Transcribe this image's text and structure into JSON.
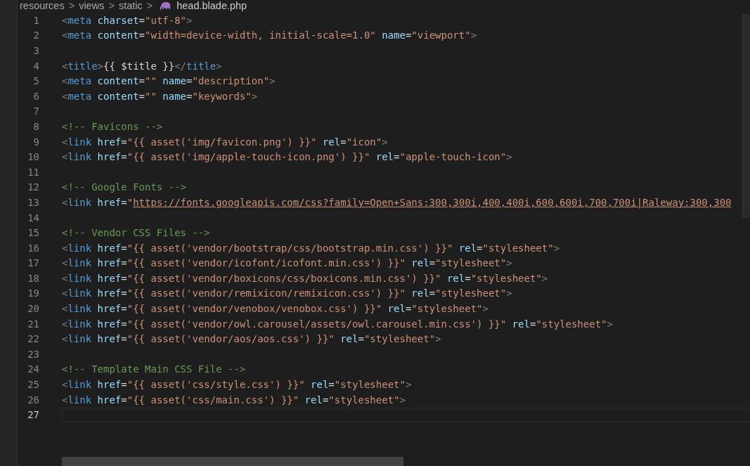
{
  "breadcrumb": {
    "parts": [
      "resources",
      "views",
      "static"
    ],
    "separator": ">",
    "file": "head.blade.php"
  },
  "lines": [
    {
      "number": "1",
      "current": false,
      "segments": [
        {
          "kind": "punct",
          "text": "<"
        },
        {
          "kind": "tag",
          "text": "meta"
        },
        {
          "kind": "attr",
          "text": " charset"
        },
        {
          "kind": "text",
          "text": "="
        },
        {
          "kind": "string",
          "text": "\"utf-8\""
        },
        {
          "kind": "punct",
          "text": ">"
        }
      ]
    },
    {
      "number": "2",
      "current": false,
      "segments": [
        {
          "kind": "punct",
          "text": "<"
        },
        {
          "kind": "tag",
          "text": "meta"
        },
        {
          "kind": "attr",
          "text": " content"
        },
        {
          "kind": "text",
          "text": "="
        },
        {
          "kind": "string",
          "text": "\"width=device-width, initial-scale=1.0\""
        },
        {
          "kind": "attr",
          "text": " name"
        },
        {
          "kind": "text",
          "text": "="
        },
        {
          "kind": "string",
          "text": "\"viewport\""
        },
        {
          "kind": "punct",
          "text": ">"
        }
      ]
    },
    {
      "number": "3",
      "current": false
    },
    {
      "number": "4",
      "current": false,
      "segments": [
        {
          "kind": "punct",
          "text": "<"
        },
        {
          "kind": "tag",
          "text": "title"
        },
        {
          "kind": "punct",
          "text": ">"
        },
        {
          "kind": "text",
          "text": "{{ $title }}"
        },
        {
          "kind": "punct",
          "text": "</"
        },
        {
          "kind": "tag",
          "text": "title"
        },
        {
          "kind": "punct",
          "text": ">"
        }
      ]
    },
    {
      "number": "5",
      "current": false,
      "segments": [
        {
          "kind": "punct",
          "text": "<"
        },
        {
          "kind": "tag",
          "text": "meta"
        },
        {
          "kind": "attr",
          "text": " content"
        },
        {
          "kind": "text",
          "text": "="
        },
        {
          "kind": "string",
          "text": "\"\""
        },
        {
          "kind": "attr",
          "text": " name"
        },
        {
          "kind": "text",
          "text": "="
        },
        {
          "kind": "string",
          "text": "\"description\""
        },
        {
          "kind": "punct",
          "text": ">"
        }
      ]
    },
    {
      "number": "6",
      "current": false,
      "segments": [
        {
          "kind": "punct",
          "text": "<"
        },
        {
          "kind": "tag",
          "text": "meta"
        },
        {
          "kind": "attr",
          "text": " content"
        },
        {
          "kind": "text",
          "text": "="
        },
        {
          "kind": "string",
          "text": "\"\""
        },
        {
          "kind": "attr",
          "text": " name"
        },
        {
          "kind": "text",
          "text": "="
        },
        {
          "kind": "string",
          "text": "\"keywords\""
        },
        {
          "kind": "punct",
          "text": ">"
        }
      ]
    },
    {
      "number": "7",
      "current": false
    },
    {
      "number": "8",
      "current": false,
      "segments": [
        {
          "kind": "comment",
          "text": "<!-- Favicons -->"
        }
      ]
    },
    {
      "number": "9",
      "current": false,
      "segments": [
        {
          "kind": "punct",
          "text": "<"
        },
        {
          "kind": "tag",
          "text": "link"
        },
        {
          "kind": "attr",
          "text": " href"
        },
        {
          "kind": "text",
          "text": "="
        },
        {
          "kind": "string",
          "text": "\"{{ asset('img/favicon.png') }}\""
        },
        {
          "kind": "attr",
          "text": " rel"
        },
        {
          "kind": "text",
          "text": "="
        },
        {
          "kind": "string",
          "text": "\"icon\""
        },
        {
          "kind": "punct",
          "text": ">"
        }
      ]
    },
    {
      "number": "10",
      "current": false,
      "segments": [
        {
          "kind": "punct",
          "text": "<"
        },
        {
          "kind": "tag",
          "text": "link"
        },
        {
          "kind": "attr",
          "text": " href"
        },
        {
          "kind": "text",
          "text": "="
        },
        {
          "kind": "string",
          "text": "\"{{ asset('img/apple-touch-icon.png') }}\""
        },
        {
          "kind": "attr",
          "text": " rel"
        },
        {
          "kind": "text",
          "text": "="
        },
        {
          "kind": "string",
          "text": "\"apple-touch-icon\""
        },
        {
          "kind": "punct",
          "text": ">"
        }
      ]
    },
    {
      "number": "11",
      "current": false
    },
    {
      "number": "12",
      "current": false,
      "segments": [
        {
          "kind": "comment",
          "text": "<!-- Google Fonts -->"
        }
      ]
    },
    {
      "number": "13",
      "current": false,
      "segments": [
        {
          "kind": "punct",
          "text": "<"
        },
        {
          "kind": "tag",
          "text": "link"
        },
        {
          "kind": "attr",
          "text": " href"
        },
        {
          "kind": "text",
          "text": "="
        },
        {
          "kind": "string",
          "text": "\""
        },
        {
          "kind": "link",
          "text": "https://fonts.googleapis.com/css?family=Open+Sans:300,300i,400,400i,600,600i,700,700i|Raleway:300,300"
        }
      ]
    },
    {
      "number": "14",
      "current": false
    },
    {
      "number": "15",
      "current": false,
      "segments": [
        {
          "kind": "comment",
          "text": "<!-- Vendor CSS Files -->"
        }
      ]
    },
    {
      "number": "16",
      "current": false,
      "segments": [
        {
          "kind": "punct",
          "text": "<"
        },
        {
          "kind": "tag",
          "text": "link"
        },
        {
          "kind": "attr",
          "text": " href"
        },
        {
          "kind": "text",
          "text": "="
        },
        {
          "kind": "string",
          "text": "\"{{ asset('vendor/bootstrap/css/bootstrap.min.css') }}\""
        },
        {
          "kind": "attr",
          "text": " rel"
        },
        {
          "kind": "text",
          "text": "="
        },
        {
          "kind": "string",
          "text": "\"stylesheet\""
        },
        {
          "kind": "punct",
          "text": ">"
        }
      ]
    },
    {
      "number": "17",
      "current": false,
      "segments": [
        {
          "kind": "punct",
          "text": "<"
        },
        {
          "kind": "tag",
          "text": "link"
        },
        {
          "kind": "attr",
          "text": " href"
        },
        {
          "kind": "text",
          "text": "="
        },
        {
          "kind": "string",
          "text": "\"{{ asset('vendor/icofont/icofont.min.css') }}\""
        },
        {
          "kind": "attr",
          "text": " rel"
        },
        {
          "kind": "text",
          "text": "="
        },
        {
          "kind": "string",
          "text": "\"stylesheet\""
        },
        {
          "kind": "punct",
          "text": ">"
        }
      ]
    },
    {
      "number": "18",
      "current": false,
      "segments": [
        {
          "kind": "punct",
          "text": "<"
        },
        {
          "kind": "tag",
          "text": "link"
        },
        {
          "kind": "attr",
          "text": " href"
        },
        {
          "kind": "text",
          "text": "="
        },
        {
          "kind": "string",
          "text": "\"{{ asset('vendor/boxicons/css/boxicons.min.css') }}\""
        },
        {
          "kind": "attr",
          "text": " rel"
        },
        {
          "kind": "text",
          "text": "="
        },
        {
          "kind": "string",
          "text": "\"stylesheet\""
        },
        {
          "kind": "punct",
          "text": ">"
        }
      ]
    },
    {
      "number": "19",
      "current": false,
      "segments": [
        {
          "kind": "punct",
          "text": "<"
        },
        {
          "kind": "tag",
          "text": "link"
        },
        {
          "kind": "attr",
          "text": " href"
        },
        {
          "kind": "text",
          "text": "="
        },
        {
          "kind": "string",
          "text": "\"{{ asset('vendor/remixicon/remixicon.css') }}\""
        },
        {
          "kind": "attr",
          "text": " rel"
        },
        {
          "kind": "text",
          "text": "="
        },
        {
          "kind": "string",
          "text": "\"stylesheet\""
        },
        {
          "kind": "punct",
          "text": ">"
        }
      ]
    },
    {
      "number": "20",
      "current": false,
      "segments": [
        {
          "kind": "punct",
          "text": "<"
        },
        {
          "kind": "tag",
          "text": "link"
        },
        {
          "kind": "attr",
          "text": " href"
        },
        {
          "kind": "text",
          "text": "="
        },
        {
          "kind": "string",
          "text": "\"{{ asset('vendor/venobox/venobox.css') }}\""
        },
        {
          "kind": "attr",
          "text": " rel"
        },
        {
          "kind": "text",
          "text": "="
        },
        {
          "kind": "string",
          "text": "\"stylesheet\""
        },
        {
          "kind": "punct",
          "text": ">"
        }
      ]
    },
    {
      "number": "21",
      "current": false,
      "segments": [
        {
          "kind": "punct",
          "text": "<"
        },
        {
          "kind": "tag",
          "text": "link"
        },
        {
          "kind": "attr",
          "text": " href"
        },
        {
          "kind": "text",
          "text": "="
        },
        {
          "kind": "string",
          "text": "\"{{ asset('vendor/owl.carousel/assets/owl.carousel.min.css') }}\""
        },
        {
          "kind": "attr",
          "text": " rel"
        },
        {
          "kind": "text",
          "text": "="
        },
        {
          "kind": "string",
          "text": "\"stylesheet\""
        },
        {
          "kind": "punct",
          "text": ">"
        }
      ]
    },
    {
      "number": "22",
      "current": false,
      "segments": [
        {
          "kind": "punct",
          "text": "<"
        },
        {
          "kind": "tag",
          "text": "link"
        },
        {
          "kind": "attr",
          "text": " href"
        },
        {
          "kind": "text",
          "text": "="
        },
        {
          "kind": "string",
          "text": "\"{{ asset('vendor/aos/aos.css') }}\""
        },
        {
          "kind": "attr",
          "text": " rel"
        },
        {
          "kind": "text",
          "text": "="
        },
        {
          "kind": "string",
          "text": "\"stylesheet\""
        },
        {
          "kind": "punct",
          "text": ">"
        }
      ]
    },
    {
      "number": "23",
      "current": false
    },
    {
      "number": "24",
      "current": false,
      "segments": [
        {
          "kind": "comment",
          "text": "<!-- Template Main CSS File -->"
        }
      ]
    },
    {
      "number": "25",
      "current": false,
      "segments": [
        {
          "kind": "punct",
          "text": "<"
        },
        {
          "kind": "tag",
          "text": "link"
        },
        {
          "kind": "attr",
          "text": " href"
        },
        {
          "kind": "text",
          "text": "="
        },
        {
          "kind": "string",
          "text": "\"{{ asset('css/style.css') }}\""
        },
        {
          "kind": "attr",
          "text": " rel"
        },
        {
          "kind": "text",
          "text": "="
        },
        {
          "kind": "string",
          "text": "\"stylesheet\""
        },
        {
          "kind": "punct",
          "text": ">"
        }
      ]
    },
    {
      "number": "26",
      "current": false,
      "segments": [
        {
          "kind": "punct",
          "text": "<"
        },
        {
          "kind": "tag",
          "text": "link"
        },
        {
          "kind": "attr",
          "text": " href"
        },
        {
          "kind": "text",
          "text": "="
        },
        {
          "kind": "string",
          "text": "\"{{ asset('css/main.css') }}\""
        },
        {
          "kind": "attr",
          "text": " rel"
        },
        {
          "kind": "text",
          "text": "="
        },
        {
          "kind": "string",
          "text": "\"stylesheet\""
        },
        {
          "kind": "punct",
          "text": ">"
        }
      ]
    },
    {
      "number": "27",
      "current": true
    }
  ]
}
